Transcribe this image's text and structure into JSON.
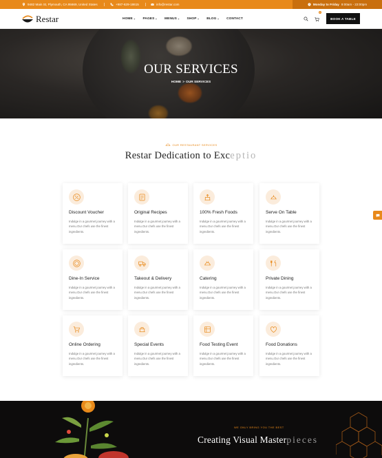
{
  "topbar": {
    "address": "9482 Main St, Plymouth, CA 95669, United States",
    "phone": "+987-629-18615",
    "email": "info@restar.com",
    "hours_label": "Monday to Friday",
    "hours_value": "9:00am - 22:00pm"
  },
  "brand": {
    "name": "Restar"
  },
  "nav": {
    "items": [
      "HOME",
      "PAGES",
      "MENUS",
      "SHOP",
      "BLOG",
      "CONTACT"
    ],
    "cart_count": "0",
    "book_label": "BOOK A TABLE"
  },
  "hero": {
    "title": "OUR SERVICES",
    "breadcrumb_home": "HOME",
    "breadcrumb_sep": ">",
    "breadcrumb_current": "OUR SERVICES"
  },
  "services": {
    "subtitle": "OUR RESTAURANT SERVICES",
    "title_main": "Restar Dedication to Exc",
    "title_fade": "eptio",
    "description": "Indulge in a gourmet journey with a menu.Our chefs use the finest ingredients.",
    "cards": [
      {
        "title": "Discount Voucher",
        "icon": "discount-icon"
      },
      {
        "title": "Original Recipes",
        "icon": "recipe-icon"
      },
      {
        "title": "100% Fresh Foods",
        "icon": "fresh-food-icon"
      },
      {
        "title": "Serve On Table",
        "icon": "serving-icon"
      },
      {
        "title": "Dine-In Service",
        "icon": "dine-in-icon"
      },
      {
        "title": "Takeout & Delivery",
        "icon": "delivery-icon"
      },
      {
        "title": "Catering",
        "icon": "catering-icon"
      },
      {
        "title": "Private Dining",
        "icon": "private-dining-icon"
      },
      {
        "title": "Online Ordering",
        "icon": "cart-icon"
      },
      {
        "title": "Special Events",
        "icon": "events-icon"
      },
      {
        "title": "Food Testing Event",
        "icon": "food-testing-icon"
      },
      {
        "title": "Food Donations",
        "icon": "donation-icon"
      }
    ]
  },
  "bottom": {
    "subtitle": "WE ONLY BRING YOU THE BEST",
    "title_main": "Creating Visual Master",
    "title_fade": "pieces"
  },
  "colors": {
    "accent": "#e8891a",
    "dark": "#111111"
  }
}
